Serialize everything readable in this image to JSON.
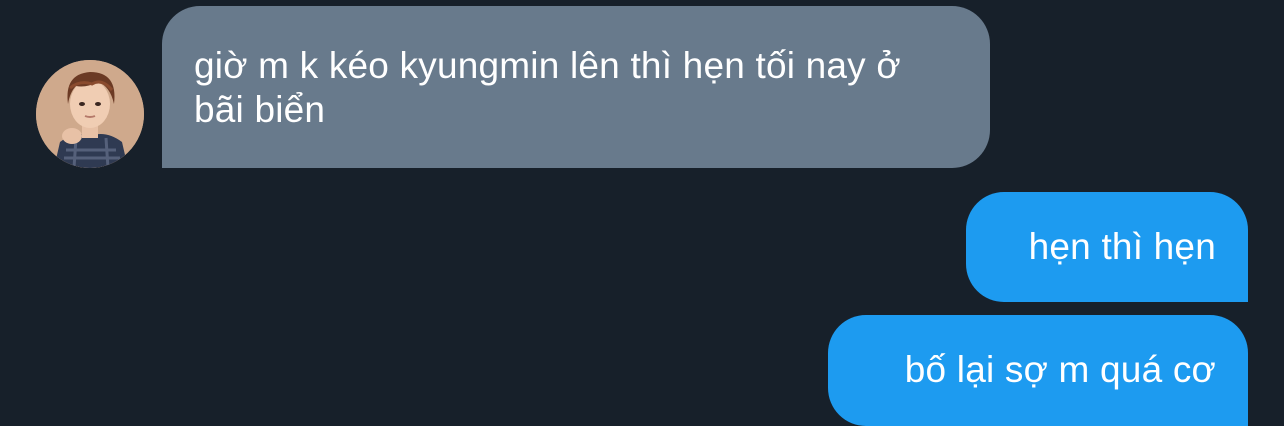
{
  "conversation": {
    "messages": [
      {
        "direction": "incoming",
        "text": "giờ m k kéo kyungmin lên thì hẹn tối nay ở bãi biển",
        "sender_avatar": "user-avatar-photo"
      },
      {
        "direction": "outgoing",
        "text": "hẹn thì hẹn"
      },
      {
        "direction": "outgoing",
        "text": "bố lại sợ m quá cơ"
      }
    ]
  },
  "colors": {
    "background": "#17202a",
    "incoming_bubble": "#687a8c",
    "outgoing_bubble": "#1d9bf0",
    "text": "#ffffff"
  }
}
